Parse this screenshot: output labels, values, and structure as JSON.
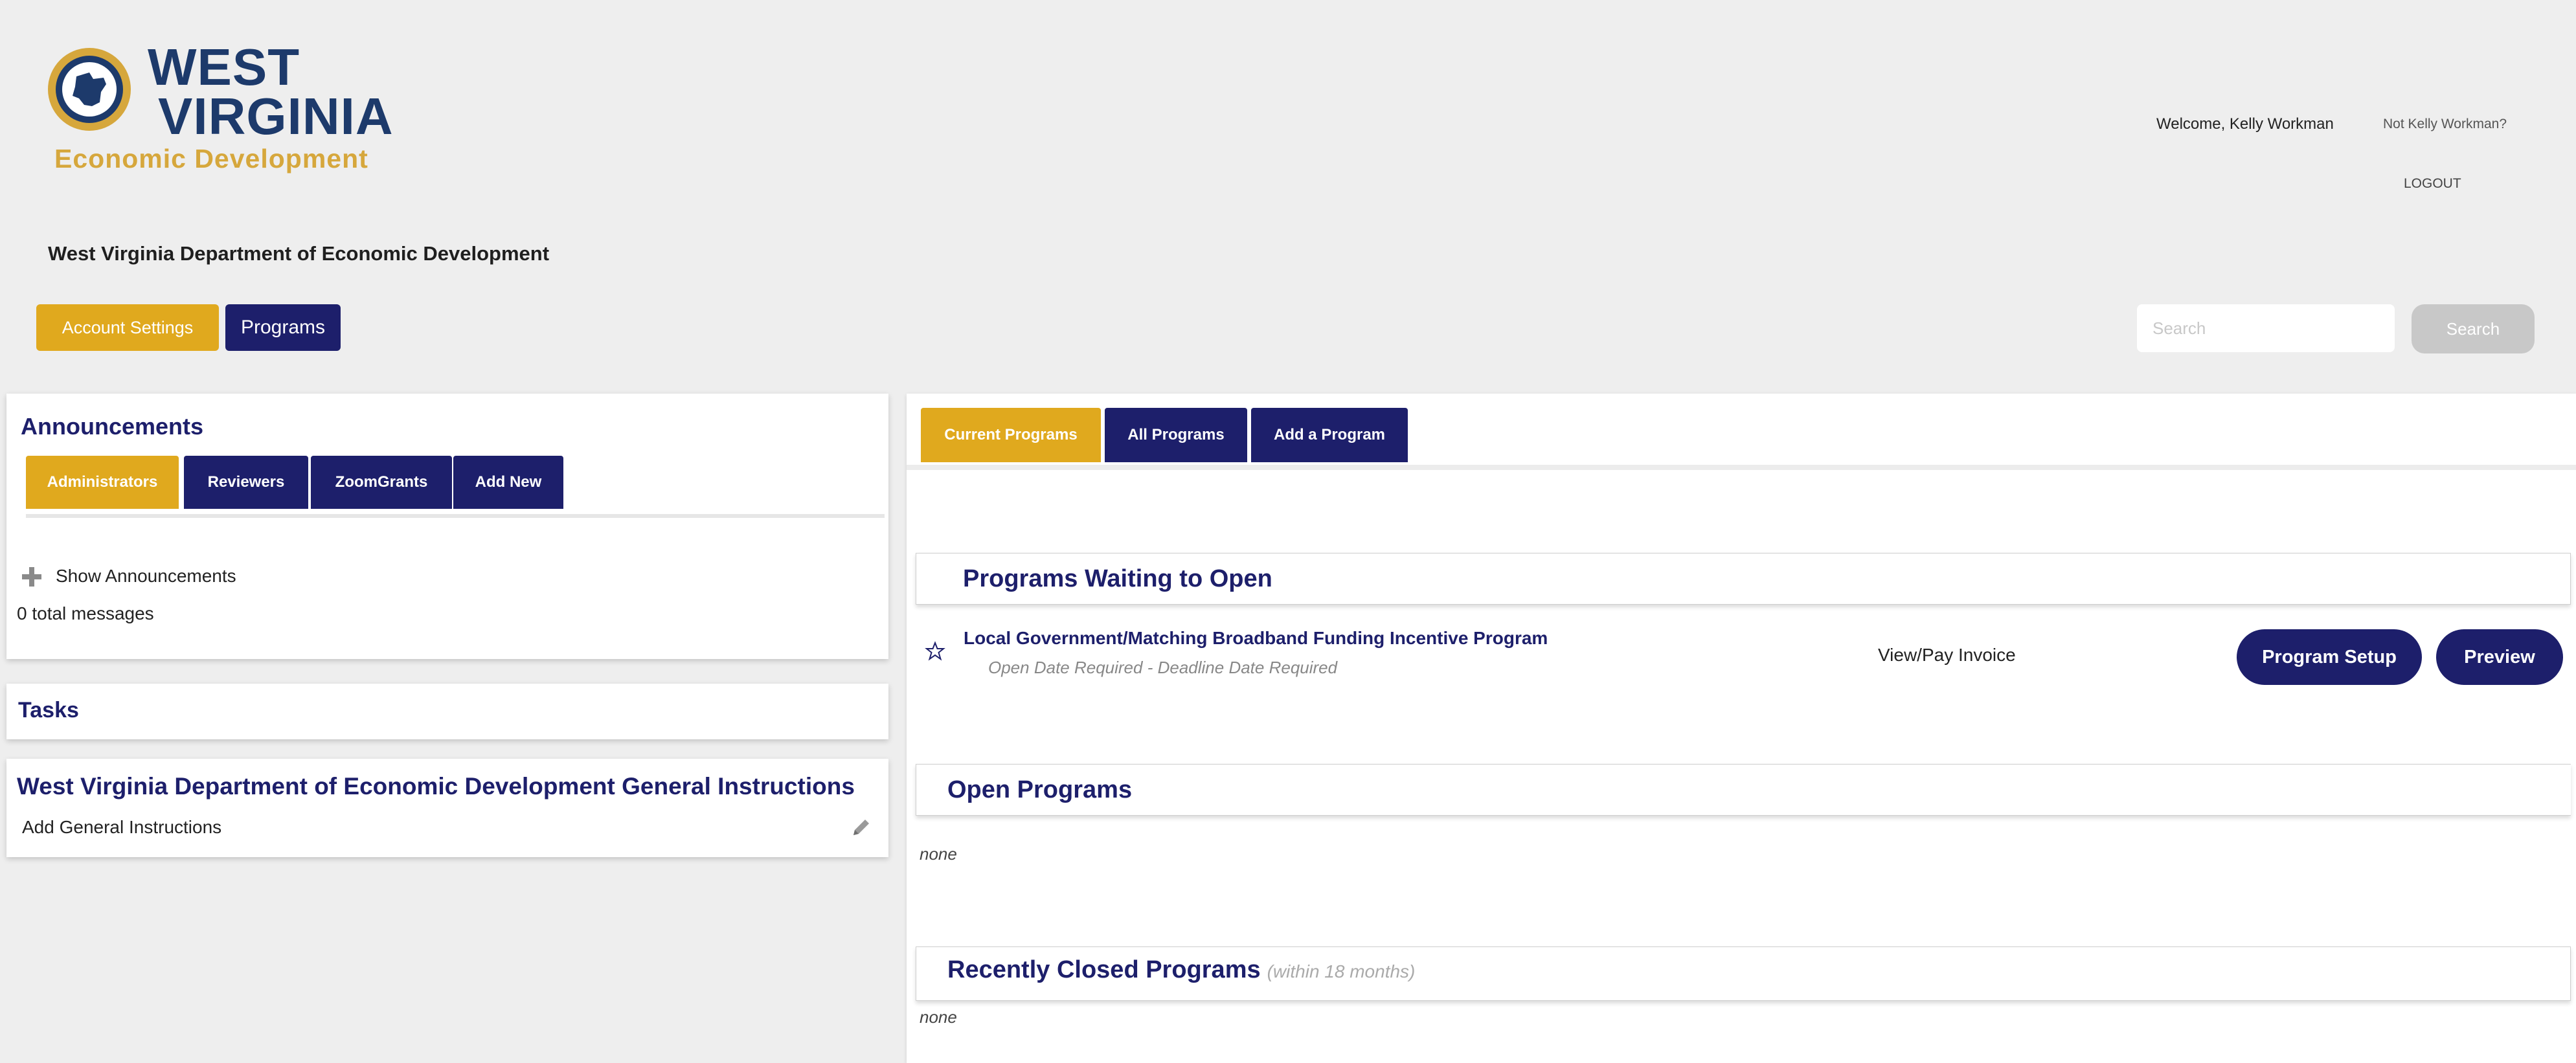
{
  "header": {
    "logo": {
      "line1": "WEST",
      "line2": "VIRGINIA",
      "tagline": "Economic Development"
    },
    "org_name": "West Virginia Department of Economic Development",
    "welcome": "Welcome, Kelly Workman",
    "not_user": "Not Kelly Workman?",
    "logout": "LOGOUT",
    "nav": {
      "account_settings": "Account Settings",
      "programs": "Programs"
    },
    "search": {
      "placeholder": "Search",
      "button": "Search"
    }
  },
  "announcements": {
    "title": "Announcements",
    "tabs": [
      "Administrators",
      "Reviewers",
      "ZoomGrants",
      "Add New"
    ],
    "show_label": "Show Announcements",
    "total": "0 total messages"
  },
  "tasks": {
    "title": "Tasks"
  },
  "general_instructions": {
    "title": "West Virginia Department of Economic Development General Instructions",
    "add_label": "Add General Instructions"
  },
  "programs_panel": {
    "tabs": [
      "Current Programs",
      "All Programs",
      "Add a Program"
    ],
    "waiting": {
      "title": "Programs Waiting to Open",
      "program_name": "Local Government/Matching Broadband Funding Incentive Program",
      "program_dates": "Open Date Required - Deadline Date Required",
      "view_pay": "View/Pay Invoice",
      "setup_button": "Program Setup",
      "preview_button": "Preview"
    },
    "open": {
      "title": "Open Programs",
      "empty": "none"
    },
    "closed": {
      "title": "Recently Closed Programs",
      "note": "(within 18 months)",
      "empty": "none"
    }
  },
  "colors": {
    "navy": "#1d1f6b",
    "gold": "#e0a91e",
    "logo_blue": "#1d3a6b"
  },
  "icons": {
    "logo": "wv-state-icon",
    "plus": "plus-icon",
    "edit": "pencil-icon",
    "favorite": "star-icon"
  }
}
